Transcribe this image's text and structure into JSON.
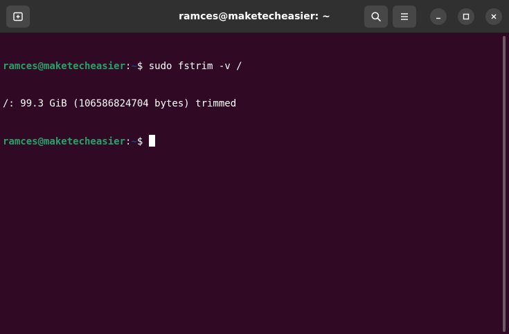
{
  "window": {
    "title": "ramces@maketecheasier: ~"
  },
  "titlebar": {
    "new_tab_icon": "new-tab-icon",
    "search_icon": "search-icon",
    "menu_icon": "hamburger-menu-icon",
    "minimize_icon": "minimize-icon",
    "maximize_icon": "maximize-icon",
    "close_icon": "close-icon"
  },
  "terminal": {
    "lines": [
      {
        "user": "ramces@maketecheasier",
        "sep1": ":",
        "path": "~",
        "prompt": "$ ",
        "command": "sudo fstrim -v /"
      },
      {
        "output": "/: 99.3 GiB (106586824704 bytes) trimmed"
      },
      {
        "user": "ramces@maketecheasier",
        "sep1": ":",
        "path": "~",
        "prompt": "$ ",
        "command": ""
      }
    ]
  },
  "colors": {
    "background": "#300a24",
    "titlebar": "#303030",
    "user": "#26a269",
    "path": "#12488b",
    "text": "#ffffff"
  }
}
